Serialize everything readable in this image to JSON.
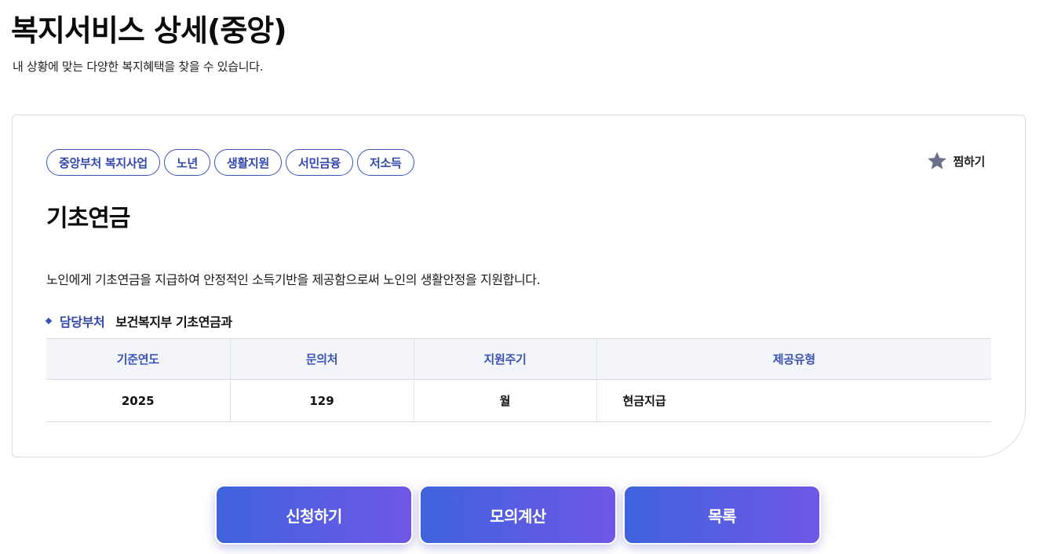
{
  "header": {
    "title": "복지서비스 상세(중앙)",
    "subtitle": "내 상황에 맞는 다양한 복지혜택을 찾을 수 있습니다."
  },
  "card": {
    "tags": [
      "중앙부처 복지사업",
      "노년",
      "생활지원",
      "서민금융",
      "저소득"
    ],
    "favorite_label": "찜하기",
    "favorite_icon": "star-icon",
    "title": "기초연금",
    "description": "노인에게 기초연금을 지급하여 안정적인 소득기반을 제공함으로써 노인의 생활안정을 지원합니다.",
    "department": {
      "label": "담당부처",
      "value": "보건복지부 기초연금과"
    },
    "table": {
      "headers": [
        "기준연도",
        "문의처",
        "지원주기",
        "제공유형"
      ],
      "row": [
        "2025",
        "129",
        "월",
        "현금지급"
      ]
    }
  },
  "actions": {
    "apply": "신청하기",
    "simulate": "모의계산",
    "list": "목록"
  },
  "colors": {
    "accent": "#3248ab",
    "button_gradient_start": "#3f63dc",
    "button_gradient_end": "#6f57e6",
    "table_header_bg": "#f4f5fa"
  }
}
